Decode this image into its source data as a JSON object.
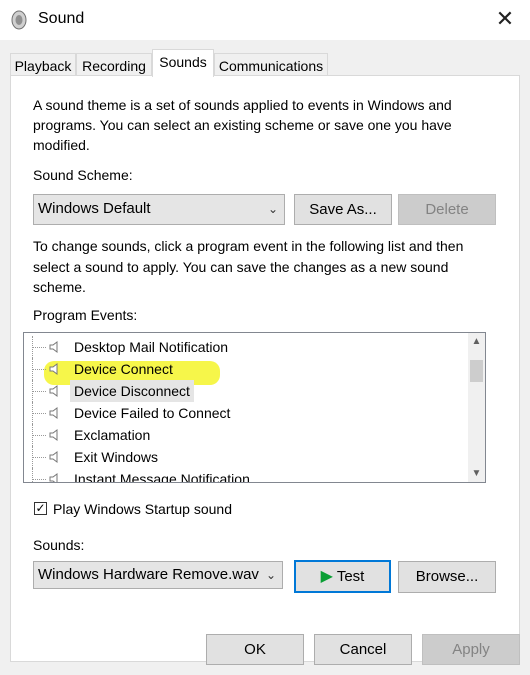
{
  "window": {
    "title": "Sound",
    "close_glyph": "✕"
  },
  "tabs": [
    {
      "label": "Playback"
    },
    {
      "label": "Recording"
    },
    {
      "label": "Sounds"
    },
    {
      "label": "Communications"
    }
  ],
  "intro_text_1": "A sound theme is a set of sounds applied to events in Windows and",
  "intro_text_2": "programs.  You can select an existing scheme or save one you have",
  "intro_text_3": "modified.",
  "scheme": {
    "label": "Sound Scheme:",
    "value": "Windows Default",
    "save_as": "Save As...",
    "delete": "Delete"
  },
  "change_text_1": "To change sounds, click a program event in the following list and then",
  "change_text_2": "select a sound to apply.  You can save the changes as a new sound",
  "change_text_3": "scheme.",
  "events": {
    "label": "Program Events:",
    "items": [
      "Desktop Mail Notification",
      "Device Connect",
      "Device Disconnect",
      "Device Failed to Connect",
      "Exclamation",
      "Exit Windows",
      "Instant Message Notification"
    ]
  },
  "startup": {
    "label": "Play Windows Startup sound",
    "checked": true,
    "check_glyph": "✓"
  },
  "sounds": {
    "label": "Sounds:",
    "value": "Windows Hardware Remove.wav",
    "test": "Test",
    "browse": "Browse..."
  },
  "footer": {
    "ok": "OK",
    "cancel": "Cancel",
    "apply": "Apply"
  },
  "colors": {
    "highlight": "#f4f42a",
    "play_green": "#0a9e34",
    "accent": "#0078d7"
  }
}
